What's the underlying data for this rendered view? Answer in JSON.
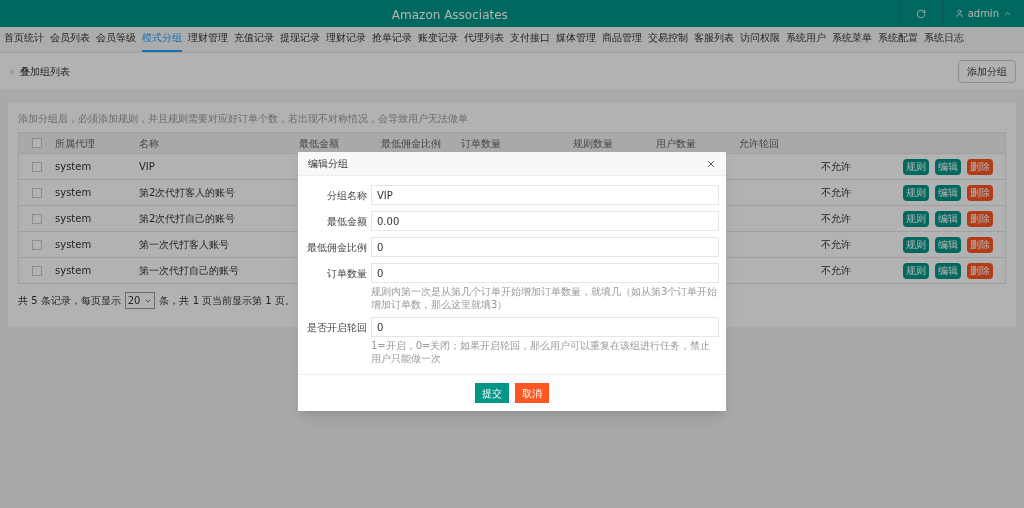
{
  "header": {
    "title": "Amazon Associates",
    "user": "admin"
  },
  "nav": [
    {
      "label": "首页统计",
      "selected": false
    },
    {
      "label": "会员列表",
      "selected": false
    },
    {
      "label": "会员等级",
      "selected": false
    },
    {
      "label": "模式分组",
      "selected": true
    },
    {
      "label": "理财管理",
      "selected": false
    },
    {
      "label": "充值记录",
      "selected": false
    },
    {
      "label": "提现记录",
      "selected": false
    },
    {
      "label": "理财记录",
      "selected": false
    },
    {
      "label": "抢单记录",
      "selected": false
    },
    {
      "label": "账变记录",
      "selected": false
    },
    {
      "label": "代理列表",
      "selected": false
    },
    {
      "label": "支付接口",
      "selected": false
    },
    {
      "label": "媒体管理",
      "selected": false
    },
    {
      "label": "商品管理",
      "selected": false
    },
    {
      "label": "交易控制",
      "selected": false
    },
    {
      "label": "客服列表",
      "selected": false
    },
    {
      "label": "访问权限",
      "selected": false
    },
    {
      "label": "系统用户",
      "selected": false
    },
    {
      "label": "系统菜单",
      "selected": false
    },
    {
      "label": "系统配置",
      "selected": false
    },
    {
      "label": "系统日志",
      "selected": false
    }
  ],
  "breadcrumb": "叠加组列表",
  "add_button": "添加分组",
  "notice": "添加分组后，必须添加规则，并且规则需要对应好订单个数，若出现不对称情况，会导致用户无法做单",
  "table": {
    "all_checked": false,
    "columns": [
      "所属代理",
      "名称",
      "最低金额",
      "最低佣金比例",
      "订单数量",
      "规则数量",
      "用户数量",
      "允许轮回"
    ],
    "rows": [
      {
        "checked": false,
        "agent": "system",
        "name": "VIP",
        "loop": "不允许",
        "actions": [
          "规则",
          "编辑",
          "删除"
        ]
      },
      {
        "checked": false,
        "agent": "system",
        "name": "第2次代打客人的账号",
        "loop": "不允许",
        "actions": [
          "规则",
          "编辑",
          "删除"
        ]
      },
      {
        "checked": false,
        "agent": "system",
        "name": "第2次代打自己的账号",
        "loop": "不允许",
        "actions": [
          "规则",
          "编辑",
          "删除"
        ]
      },
      {
        "checked": false,
        "agent": "system",
        "name": "第一次代打客人账号",
        "loop": "不允许",
        "actions": [
          "规则",
          "编辑",
          "删除"
        ]
      },
      {
        "checked": false,
        "agent": "system",
        "name": "第一次代打自己的账号",
        "loop": "不允许",
        "actions": [
          "规则",
          "编辑",
          "删除"
        ]
      }
    ]
  },
  "pager": {
    "before": "共 5 条记录，每页显示",
    "page_size": "20",
    "after": "条，共 1 页当前显示第 1 页。"
  },
  "dialog": {
    "title": "编辑分组",
    "fields": [
      {
        "label": "分组名称",
        "value": "VIP"
      },
      {
        "label": "最低金额",
        "value": "0.00"
      },
      {
        "label": "最低佣金比例",
        "value": "0"
      },
      {
        "label": "订单数量",
        "value": "0",
        "hint": "规则内第一次是从第几个订单开始增加订单数量，就填几（如从第3个订单开始增加订单数，那么这里就填3）"
      },
      {
        "label": "是否开启轮回",
        "value": "0",
        "hint": "1=开启，0=关闭；如果开启轮回，那么用户可以重复在该组进行任务，禁止用户只能做一次"
      }
    ],
    "buttons": [
      {
        "label": "提交",
        "kind": "primary"
      },
      {
        "label": "取消",
        "kind": "danger"
      }
    ]
  }
}
